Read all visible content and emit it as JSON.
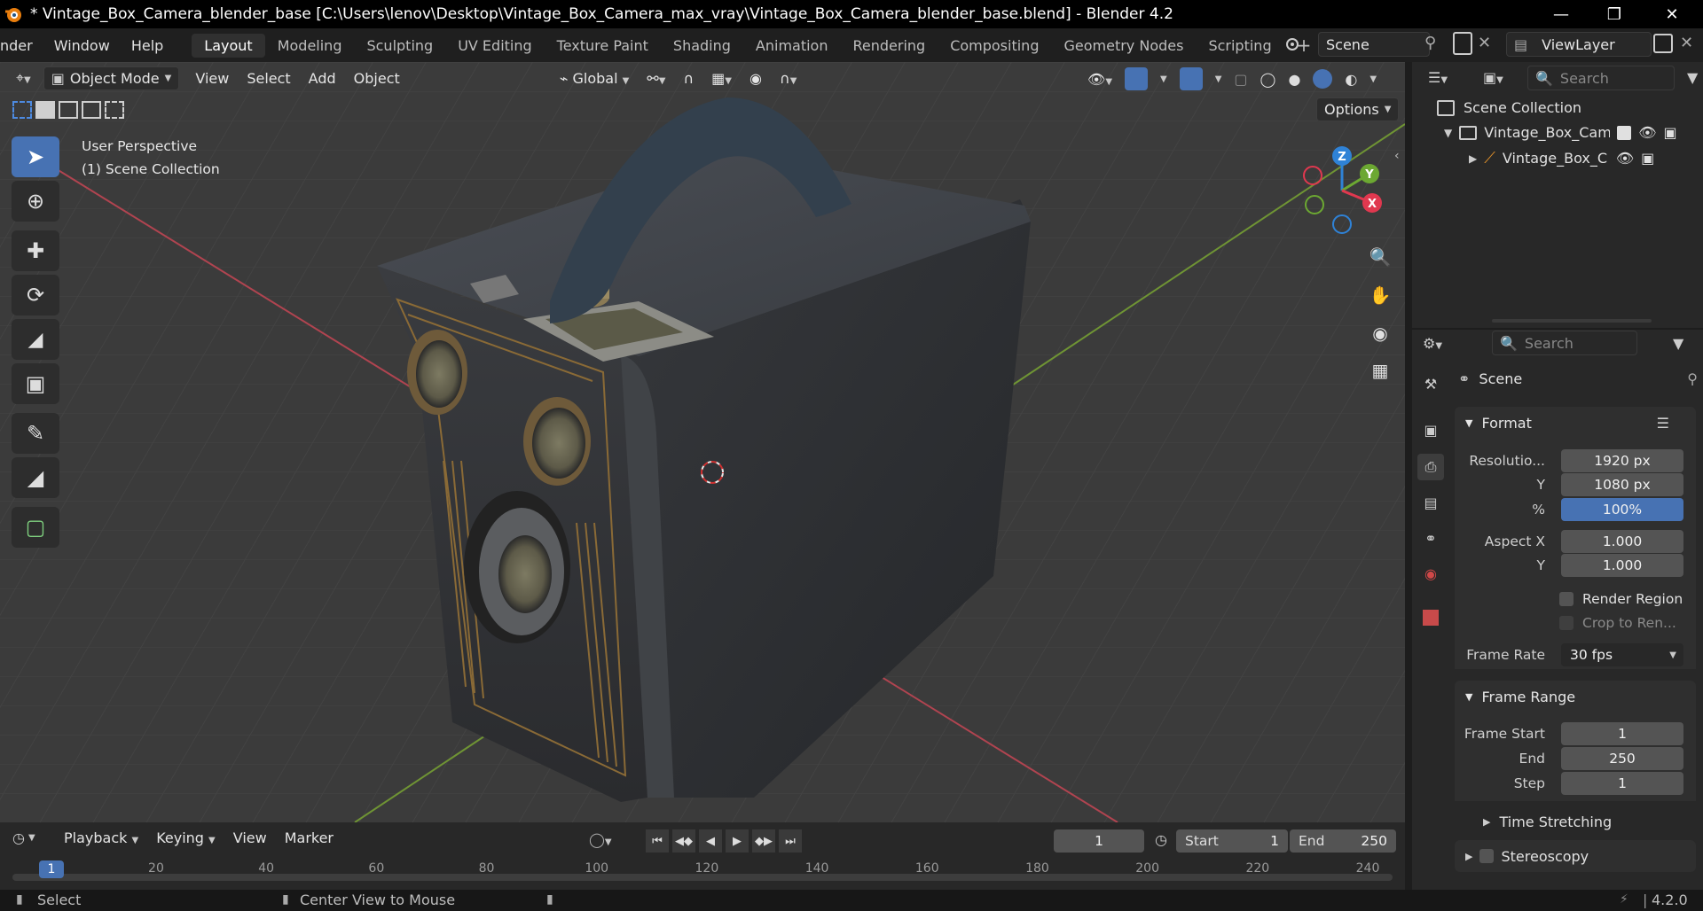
{
  "window": {
    "title": "* Vintage_Box_Camera_blender_base [C:\\Users\\lenov\\Desktop\\Vintage_Box_Camera_max_vray\\Vintage_Box_Camera_blender_base.blend] - Blender 4.2",
    "minimize_icon": "minimize-icon",
    "maximize_icon": "restore-icon",
    "close_icon": "close-icon"
  },
  "menubar": {
    "items": [
      "nder",
      "Window",
      "Help"
    ]
  },
  "workspaces": [
    "Layout",
    "Modeling",
    "Sculpting",
    "UV Editing",
    "Texture Paint",
    "Shading",
    "Animation",
    "Rendering",
    "Compositing",
    "Geometry Nodes",
    "Scripting"
  ],
  "active_workspace": "Layout",
  "scene_selector": {
    "value": "Scene"
  },
  "viewlayer_selector": {
    "value": "ViewLayer"
  },
  "viewport": {
    "mode": "Object Mode",
    "menus": [
      "View",
      "Select",
      "Add",
      "Object"
    ],
    "transform_orientation": "Global",
    "options_label": "Options",
    "overlay_text": [
      "User Perspective",
      "(1) Scene Collection"
    ],
    "gizmo": {
      "z": "Z",
      "y": "Y",
      "x": "X"
    }
  },
  "outliner": {
    "search_placeholder": "Search",
    "root": "Scene Collection",
    "collection": "Vintage_Box_Came",
    "object": "Vintage_Box_C"
  },
  "properties": {
    "search_placeholder": "Search",
    "context": "Scene",
    "format": {
      "title": "Format",
      "resolution_label": "Resolutio...",
      "resolution_x": "1920 px",
      "y_label": "Y",
      "resolution_y": "1080 px",
      "percent_label": "%",
      "percent": "100%",
      "aspect_x_label": "Aspect X",
      "aspect_x": "1.000",
      "aspect_y_label": "Y",
      "aspect_y": "1.000",
      "render_region": "Render Region",
      "crop": "Crop to Ren...",
      "frame_rate_label": "Frame Rate",
      "frame_rate": "30 fps"
    },
    "frame_range": {
      "title": "Frame Range",
      "start_label": "Frame Start",
      "start": "1",
      "end_label": "End",
      "end": "250",
      "step_label": "Step",
      "step": "1"
    },
    "time_stretching": "Time Stretching",
    "stereoscopy": "Stereoscopy"
  },
  "timeline": {
    "menus": [
      "Playback",
      "Keying",
      "View",
      "Marker"
    ],
    "current_frame": "1",
    "start_label": "Start",
    "start": "1",
    "end_label": "End",
    "end": "250",
    "ticks": [
      "1",
      "20",
      "40",
      "60",
      "80",
      "100",
      "120",
      "140",
      "160",
      "180",
      "200",
      "220",
      "240"
    ]
  },
  "statusbar": {
    "select": "Select",
    "center_view": "Center View to Mouse",
    "version": "4.2.0"
  },
  "colors": {
    "accent_blue": "#4772b3",
    "axis_red": "#c84650",
    "axis_green": "#7aa23a",
    "gizmo_z": "#2f82d6",
    "gizmo_y": "#6ca832",
    "gizmo_x": "#e0384f"
  }
}
